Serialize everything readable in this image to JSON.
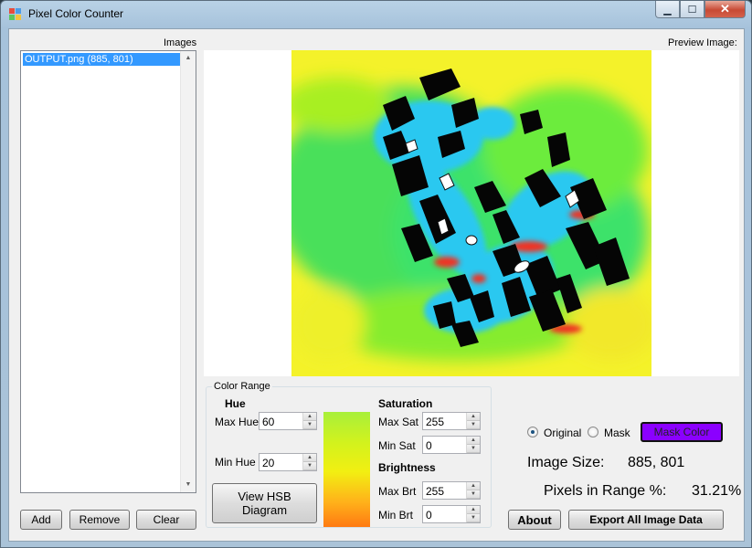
{
  "window": {
    "title": "Pixel Color Counter"
  },
  "images_panel": {
    "label": "Images",
    "items": [
      "OUTPUT.png (885, 801)"
    ],
    "add_label": "Add",
    "remove_label": "Remove",
    "clear_label": "Clear"
  },
  "preview": {
    "label": "Preview Image:"
  },
  "color_range": {
    "title": "Color Range",
    "hue_heading": "Hue",
    "max_hue_label": "Max Hue",
    "max_hue": "60",
    "min_hue_label": "Min Hue",
    "min_hue": "20",
    "saturation_heading": "Saturation",
    "max_sat_label": "Max Sat",
    "max_sat": "255",
    "min_sat_label": "Min Sat",
    "min_sat": "0",
    "brightness_heading": "Brightness",
    "max_brt_label": "Max Brt",
    "max_brt": "255",
    "min_brt_label": "Min Brt",
    "min_brt": "0",
    "view_hsb_label": "View HSB Diagram",
    "gradient_colors": [
      "#a8f03a",
      "#f2ef12",
      "#ffb21a",
      "#ff7a12"
    ]
  },
  "display_mode": {
    "original_label": "Original",
    "mask_label": "Mask",
    "selected": "Original",
    "mask_color_label": "Mask Color",
    "mask_color": "#8b00ff"
  },
  "stats": {
    "image_size_label": "Image Size:",
    "image_size": "885, 801",
    "pixels_label": "Pixels in Range %:",
    "pixels_value": "31.21%"
  },
  "about_label": "About",
  "export_label": "Export All Image Data",
  "colors": {
    "selection": "#3399ff",
    "close": "#c84a35"
  }
}
